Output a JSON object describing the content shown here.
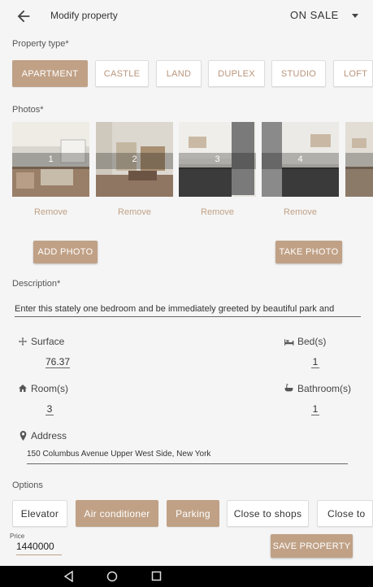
{
  "header": {
    "title": "Modify property",
    "status": "ON SALE"
  },
  "property_type": {
    "label": "Property type*",
    "options": [
      "APARTMENT",
      "CASTLE",
      "LAND",
      "DUPLEX",
      "STUDIO",
      "LOFT"
    ],
    "selected": "APARTMENT"
  },
  "photos": {
    "label": "Photos*",
    "items": [
      {
        "number": "1",
        "remove_label": "Remove"
      },
      {
        "number": "2",
        "remove_label": "Remove"
      },
      {
        "number": "3",
        "remove_label": "Remove"
      },
      {
        "number": "4",
        "remove_label": "Remove"
      }
    ],
    "add_label": "ADD PHOTO",
    "take_label": "TAKE PHOTO"
  },
  "description": {
    "label": "Description*",
    "value": "Enter this stately one bedroom and be immediately greeted by beautiful park and"
  },
  "fields": {
    "surface_label": "Surface",
    "surface_value": "76.37",
    "beds_label": "Bed(s)",
    "beds_value": "1",
    "rooms_label": "Room(s)",
    "rooms_value": "3",
    "bathrooms_label": "Bathroom(s)",
    "bathrooms_value": "1",
    "address_label": "Address",
    "address_value": "150 Columbus Avenue Upper West Side, New York"
  },
  "options": {
    "label": "Options",
    "items": [
      "Elevator",
      "Air conditioner",
      "Parking",
      "Close to shops",
      "Close to"
    ],
    "selected": [
      "Air conditioner",
      "Parking"
    ]
  },
  "footer": {
    "price_label": "Price",
    "price_value": "1440000",
    "save_label": "SAVE PROPERTY"
  },
  "icons": [
    "back-arrow-icon",
    "dropdown-icon",
    "surface-icon",
    "bed-icon",
    "home-icon",
    "bathroom-icon",
    "location-pin-icon",
    "nav-back-icon",
    "nav-home-icon",
    "nav-recents-icon"
  ],
  "colors": {
    "accent": "#c0a186",
    "background": "#f5f5f5"
  }
}
